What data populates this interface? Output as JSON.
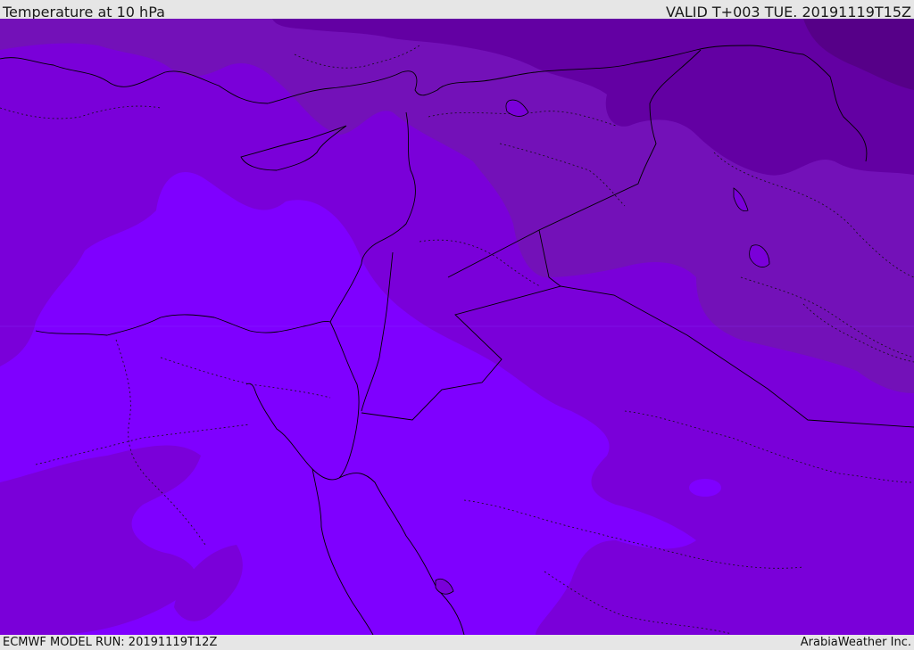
{
  "header": {
    "title": "Temperature at 10 hPa",
    "valid": "VALID T+003 TUE. 20191119T15Z"
  },
  "footer": {
    "model_run": "ECMWF MODEL RUN: 20191119T12Z",
    "credit": "ArabiaWeather Inc."
  },
  "colors": {
    "band_darkest": "#560088",
    "band_dark": "#6300a3",
    "band_mid_dark": "#7311b8",
    "band_mid": "#7a00d9",
    "band_light": "#7f00ff",
    "background": "#e6e6e6",
    "borders": "#000000"
  }
}
